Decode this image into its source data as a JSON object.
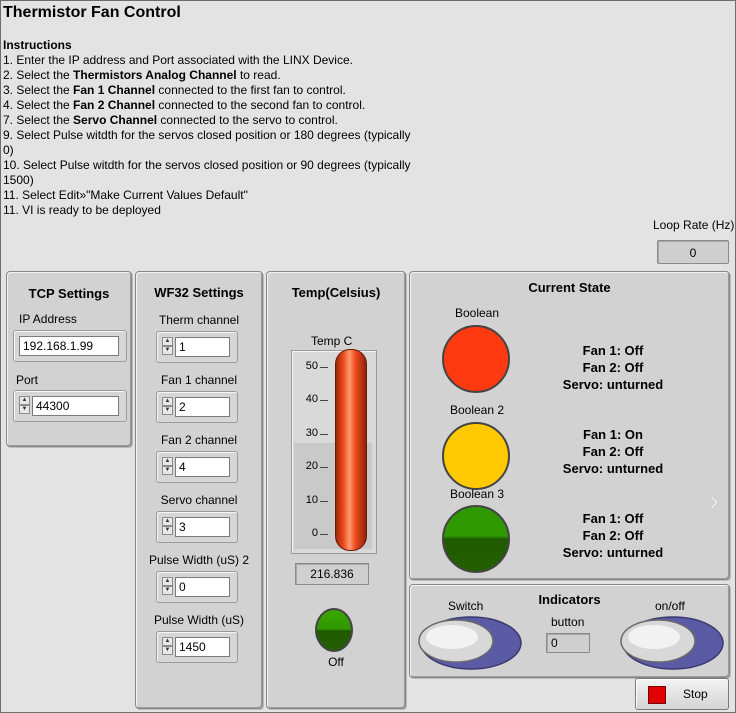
{
  "window": {
    "title": "Thermistor Fan Control"
  },
  "instructions": {
    "heading": "Instructions",
    "lines": [
      [
        {
          "t": "1. Enter the IP address and Port associated with the LINX Device."
        }
      ],
      [
        {
          "t": "2. Select the "
        },
        {
          "t": "Thermistors Analog Channel",
          "b": true
        },
        {
          "t": " to read."
        }
      ],
      [
        {
          "t": "3. Select the "
        },
        {
          "t": "Fan 1 Channel",
          "b": true
        },
        {
          "t": " connected to the first fan to control."
        }
      ],
      [
        {
          "t": "4. Select the "
        },
        {
          "t": "Fan 2 Channel",
          "b": true
        },
        {
          "t": " connected to the second fan to control."
        }
      ],
      [
        {
          "t": "7. Select the "
        },
        {
          "t": "Servo Channel",
          "b": true
        },
        {
          "t": " connected to the servo to control."
        }
      ],
      [
        {
          "t": "9. Select Pulse witdth for the servos closed position or 180 degrees (typically 0)"
        }
      ],
      [
        {
          "t": "10. Select Pulse witdth for the servos closed position or 90 degrees (typically 1500)"
        }
      ],
      [
        {
          "t": "11. Select Edit»\"Make Current Values Default\""
        }
      ],
      [
        {
          "t": "11. VI is ready to be deployed"
        }
      ]
    ]
  },
  "loop_rate": {
    "label": "Loop Rate (Hz)",
    "value": "0"
  },
  "tcp": {
    "title": "TCP Settings",
    "ip_label": "IP Address",
    "ip_value": "192.168.1.99",
    "port_label": "Port",
    "port_value": "44300"
  },
  "wf32": {
    "title": "WF32 Settings",
    "fields": [
      {
        "label": "Therm  channel",
        "value": "1"
      },
      {
        "label": "Fan 1 channel",
        "value": "2"
      },
      {
        "label": "Fan 2 channel",
        "value": "4"
      },
      {
        "label": "Servo  channel",
        "value": "3"
      },
      {
        "label": "Pulse Width (uS) 2",
        "value": "0"
      },
      {
        "label": "Pulse Width (uS)",
        "value": "1450"
      }
    ]
  },
  "temp": {
    "title": "Temp(Celsius)",
    "gauge_label": "Temp C",
    "ticks": [
      "50",
      "40",
      "30",
      "20",
      "10",
      "0"
    ],
    "scale_min": 0,
    "scale_max": 50,
    "readout": "216.836",
    "led_label": "Off",
    "colors": {
      "mercury": "#f04a1e",
      "led": "#2a8a00"
    }
  },
  "current_state": {
    "title": "Current State",
    "rows": [
      {
        "label": "Boolean",
        "color": "#ff3a10",
        "fan1": "Fan 1: Off",
        "fan2": "Fan 2: Off",
        "servo": "Servo: unturned"
      },
      {
        "label": "Boolean 2",
        "color": "#ffc800",
        "fan1": "Fan 1: On",
        "fan2": "Fan 2: Off",
        "servo": "Servo: unturned"
      },
      {
        "label": "Boolean 3",
        "color": "#2f9a00",
        "fan1": "Fan 1: Off",
        "fan2": "Fan 2: Off",
        "servo": "Servo: unturned"
      }
    ]
  },
  "indicators": {
    "title": "Indicators",
    "switch_label": "Switch",
    "button_label": "button",
    "button_value": "0",
    "onoff_label": "on/off"
  },
  "stop": {
    "label": "Stop",
    "color": "#e00000"
  }
}
